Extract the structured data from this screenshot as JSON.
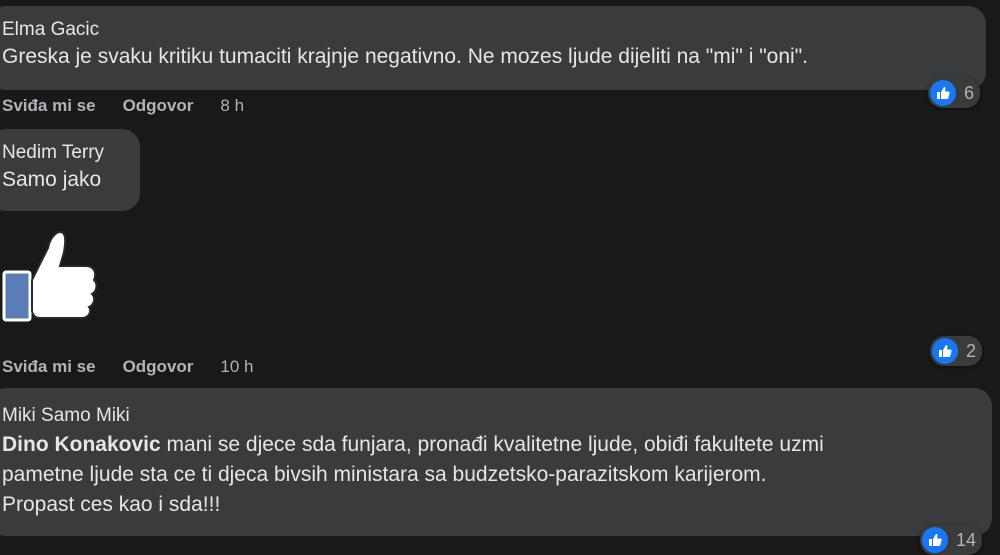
{
  "comments": [
    {
      "author": "Elma Gacic",
      "text": "Greska je svaku kritiku tumaciti krajnje negativno. Ne mozes ljude dijeliti na \"mi\" i \"oni\".",
      "like_label": "Sviđa mi se",
      "reply_label": "Odgovor",
      "time": "8 h",
      "reaction_count": "6"
    },
    {
      "author": "Nedim Terry",
      "text": "Samo jako",
      "like_label": "Sviđa mi se",
      "reply_label": "Odgovor",
      "time": "10 h",
      "reaction_count": "2",
      "sticker": "thumbs-up-sticker"
    },
    {
      "author": "Miki Samo Miki",
      "mention": "Dino Konakovic",
      "text_line1": " mani se djece sda funjara, pronađi kvalitetne ljude, obiđi fakultete uzmi",
      "text_line2": "pametne ljude sta ce ti djeca bivsih ministara sa budzetsko-parazitskom karijerom.",
      "text_line3": "Propast ces kao i sda!!!",
      "reaction_count": "14"
    }
  ],
  "colors": {
    "background": "#18191a",
    "bubble": "#3a3b3c",
    "like_blue": "#1877f2"
  }
}
